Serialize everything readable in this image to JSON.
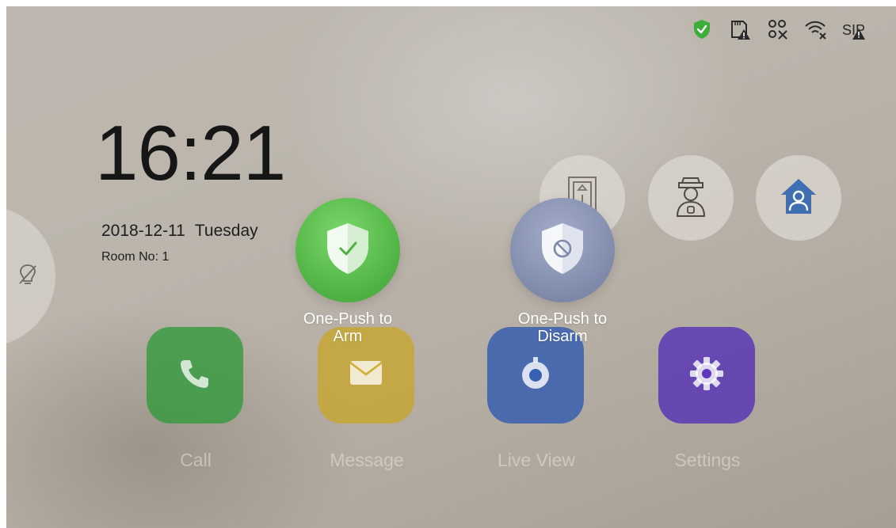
{
  "status_bar": {
    "icons": [
      "shield-check-icon",
      "sd-card-alert-icon",
      "network-disconnected-icon",
      "wifi-disconnected-icon",
      "sip-alert-icon"
    ],
    "accent_green": "#3dae3a"
  },
  "home": {
    "time": "16:21",
    "date": "2018-12-11",
    "weekday": "Tuesday",
    "room": "Room No: 1"
  },
  "quick_buttons": [
    {
      "name": "elevator",
      "icon": "elevator-icon"
    },
    {
      "name": "call-management-center",
      "icon": "security-guard-icon"
    },
    {
      "name": "home-mode",
      "icon": "home-user-icon",
      "color": "#3f6fb0"
    }
  ],
  "apps": [
    {
      "label": "Call",
      "icon": "phone-icon",
      "color": "#2f9a3a"
    },
    {
      "label": "Message",
      "icon": "envelope-icon",
      "color": "#caa521"
    },
    {
      "label": "Live View",
      "icon": "camera-icon",
      "color": "#2f5ab0"
    },
    {
      "label": "Settings",
      "icon": "gear-icon",
      "color": "#5530b5"
    }
  ],
  "overlay": {
    "arm": {
      "line1": "One-Push to",
      "line2": "Arm",
      "color": "#52b546"
    },
    "disarm": {
      "line1": "One-Push to",
      "line2": "Disarm",
      "color": "#8691b0"
    }
  }
}
